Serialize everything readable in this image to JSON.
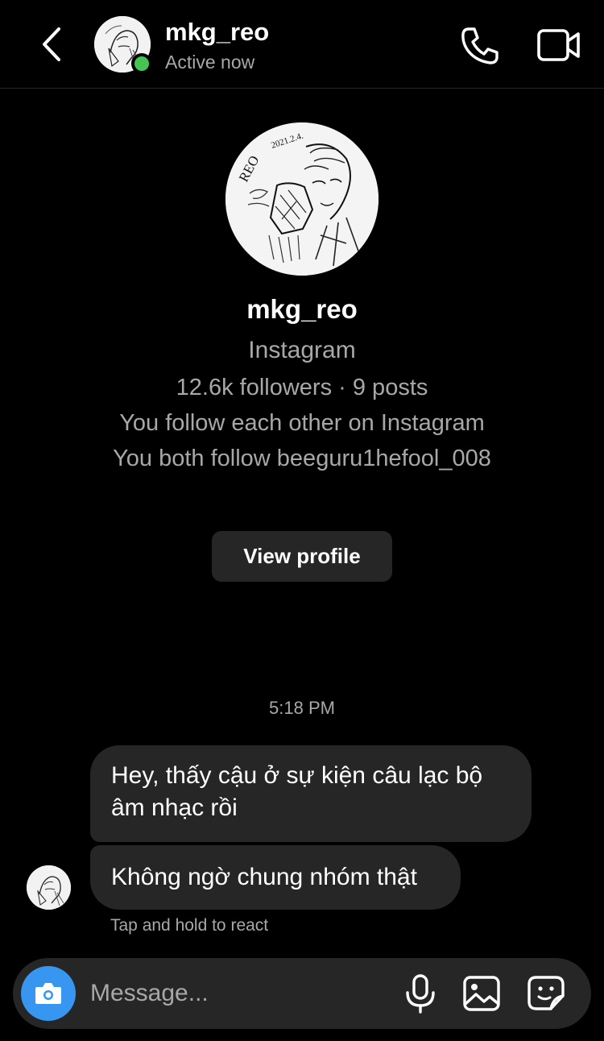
{
  "header": {
    "username": "mkg_reo",
    "status": "Active now"
  },
  "profile": {
    "name": "mkg_reo",
    "platform": "Instagram",
    "followers_count": "12.6k",
    "followers_label": "followers",
    "separator": "·",
    "posts": "9 posts",
    "mutual_text": "You follow each other on Instagram",
    "both_follow_text": "You both follow beeguru1hefool_008",
    "view_profile_label": "View profile",
    "avatar_lettering": "REO 2021.2.4."
  },
  "chat": {
    "timestamp": "5:18 PM",
    "messages": [
      {
        "text": "Hey, thấy cậu ở sự kiện câu lạc bộ âm nhạc rồi"
      },
      {
        "text": "Không ngờ chung nhóm thật"
      }
    ],
    "react_hint": "Tap and hold to react"
  },
  "composer": {
    "placeholder": "Message..."
  },
  "icons": {
    "back": "chevron-left-icon",
    "call": "phone-icon",
    "video": "video-camera-icon",
    "camera": "camera-icon",
    "mic": "microphone-icon",
    "gallery": "image-icon",
    "sticker": "sticker-icon"
  },
  "colors": {
    "background": "#000000",
    "bubble": "#262626",
    "online": "#44c553",
    "camera_button": "#3797f0",
    "secondary_text": "#a8a8a8"
  }
}
